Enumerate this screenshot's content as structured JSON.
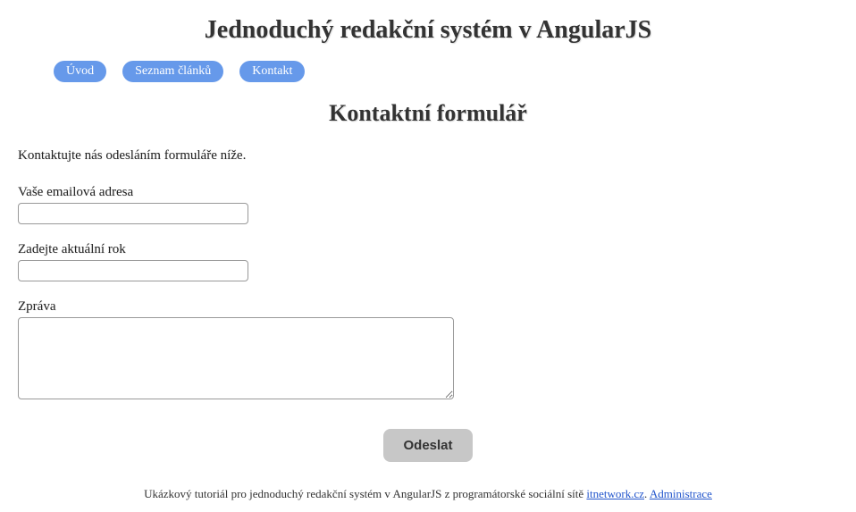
{
  "header": {
    "title": "Jednoduchý redakční systém v AngularJS"
  },
  "nav": {
    "items": [
      {
        "label": "Úvod"
      },
      {
        "label": "Seznam článků"
      },
      {
        "label": "Kontakt"
      }
    ]
  },
  "page": {
    "title": "Kontaktní formulář",
    "instructions": "Kontaktujte nás odesláním formuláře níže."
  },
  "form": {
    "email_label": "Vaše emailová adresa",
    "year_label": "Zadejte aktuální rok",
    "message_label": "Zpráva",
    "submit_label": "Odeslat"
  },
  "footer": {
    "text_before": "Ukázkový tutoriál pro jednoduchý redakční systém v AngularJS z programátorské sociální sítě ",
    "link1_label": "itnetwork.cz",
    "separator": ". ",
    "link2_label": "Administrace"
  }
}
